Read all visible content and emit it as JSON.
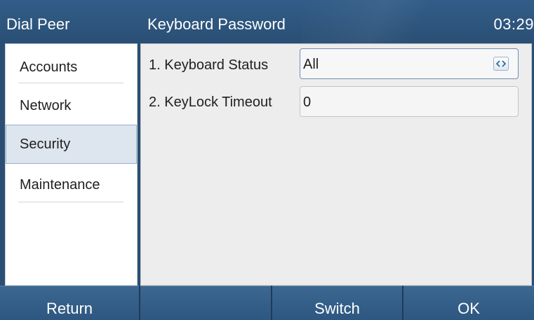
{
  "header": {
    "left_title": "Dial Peer",
    "page_title": "Keyboard Password",
    "time": "03:29"
  },
  "sidebar": {
    "items": [
      {
        "label": "Accounts",
        "selected": false
      },
      {
        "label": "Network",
        "selected": false
      },
      {
        "label": "Security",
        "selected": true
      },
      {
        "label": "Maintenance",
        "selected": false
      }
    ]
  },
  "settings": {
    "rows": [
      {
        "label": "1. Keyboard Status",
        "value": "All",
        "control": "switch",
        "icon": "left-right-arrows-icon"
      },
      {
        "label": "2. KeyLock Timeout",
        "value": "0",
        "control": "input"
      }
    ]
  },
  "softkeys": {
    "keys": [
      "Return",
      "",
      "Switch",
      "OK"
    ]
  },
  "colors": {
    "header_bg": "#2b4f74",
    "selected_item_bg": "#dde6ef",
    "content_bg": "#ededed",
    "softkey_bg": "#3c6791"
  }
}
